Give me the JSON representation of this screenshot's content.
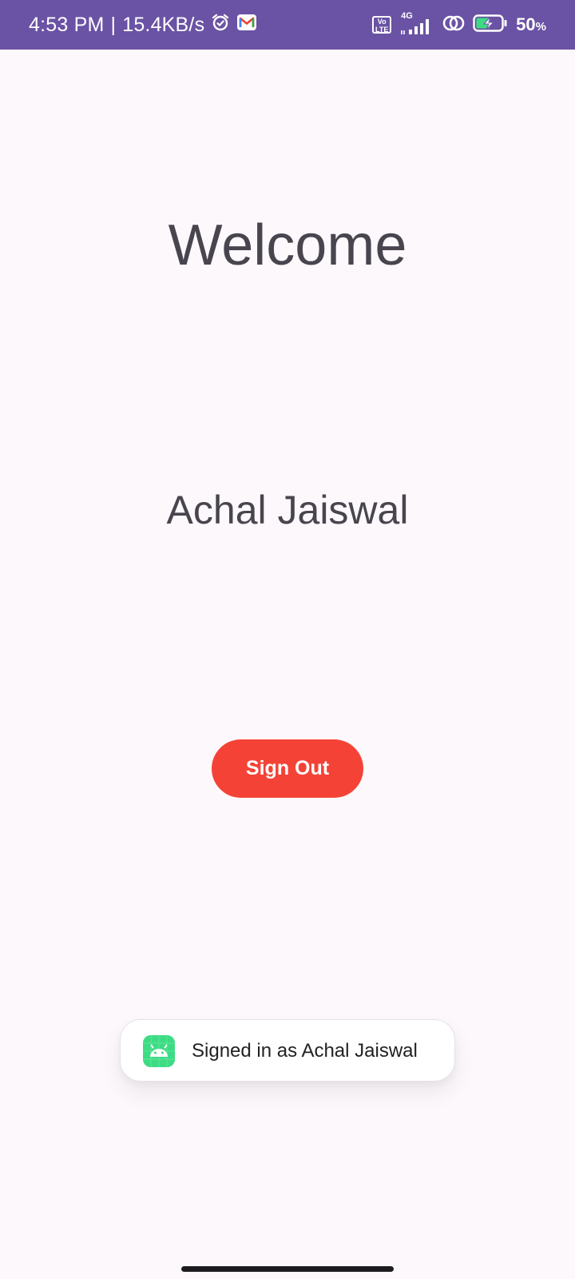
{
  "status_bar": {
    "time": "4:53 PM",
    "separator": "|",
    "network_speed": "15.4KB/s",
    "volte_label": "Vo LTE",
    "network_type": "4G",
    "battery_value": "50",
    "battery_unit": "%",
    "icons": [
      "alarm-icon",
      "gmail-icon",
      "volte-icon",
      "signal-icon",
      "hotspot-icon",
      "battery-charging-icon"
    ],
    "background_color": "#6a52a4"
  },
  "main": {
    "title": "Welcome",
    "user_name": "Achal Jaiswal",
    "sign_out_label": "Sign Out",
    "sign_out_color": "#f44336"
  },
  "toast": {
    "icon": "android-app-icon",
    "message": "Signed in as Achal Jaiswal"
  },
  "navigation": {
    "home_indicator": "home-gesture-bar"
  }
}
